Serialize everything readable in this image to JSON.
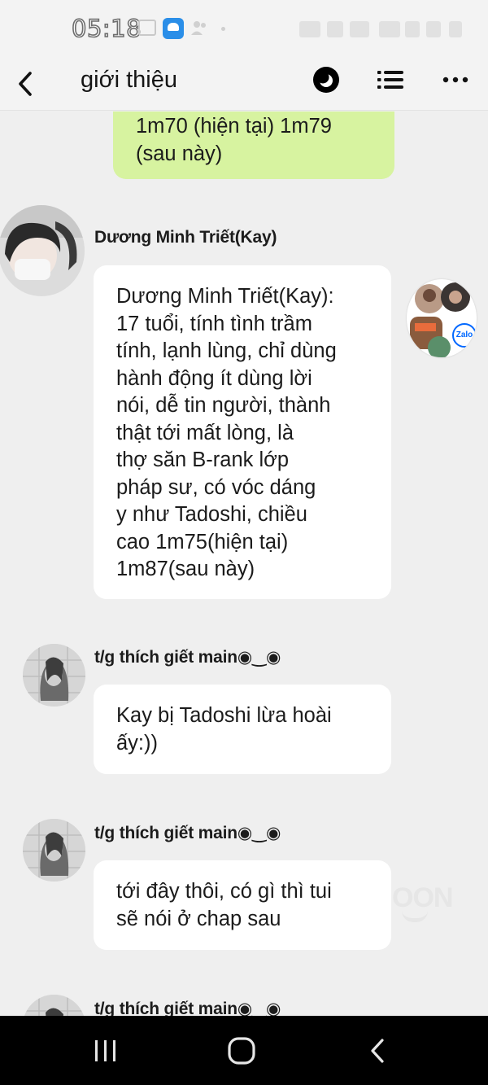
{
  "status_bar": {
    "time": "05:18"
  },
  "header": {
    "title": "giới thiệu"
  },
  "messages": [
    {
      "bubble": "1m70 (hiện tại) 1m79\n(sau này)"
    },
    {
      "sender": "Dương Minh Triết(Kay)",
      "bubble": "Dương Minh Triết(Kay):\n17 tuổi, tính tình trầm\ntính, lạnh lùng, chỉ dùng\nhành động ít dùng lời\nnói, dễ tin người, thành\nthật tới mất lòng, là\nthợ săn B-rank lớp\npháp sư, có vóc dáng\ny như Tadoshi, chiều\ncao 1m75(hiện tại)\n1m87(sau này)"
    },
    {
      "sender": "t/g thích giết main◉‿◉",
      "bubble": "Kay bị Tadoshi lừa hoài\nấy:))"
    },
    {
      "sender": "t/g thích giết main◉‿◉",
      "bubble": "tới đây thôi, có gì thì tui\nsẽ nói ở chap sau"
    },
    {
      "sender": "t/g thích giết main◉‿◉"
    }
  ],
  "floating_widget": {
    "badge": "Zalo"
  },
  "watermark": {
    "text": "OON"
  },
  "colors": {
    "background": "#efefef",
    "green_bubble": "#d7f3a0",
    "white_bubble": "#ffffff",
    "navbar": "#000000",
    "zalo_blue": "#0068ff"
  },
  "icons": {
    "back": "chevron-left-icon",
    "dark_mode": "dark-mode-icon",
    "list": "list-icon",
    "more": "more-dots-icon",
    "nav_recents": "recents-icon",
    "nav_home": "home-icon",
    "nav_back": "back-icon"
  }
}
